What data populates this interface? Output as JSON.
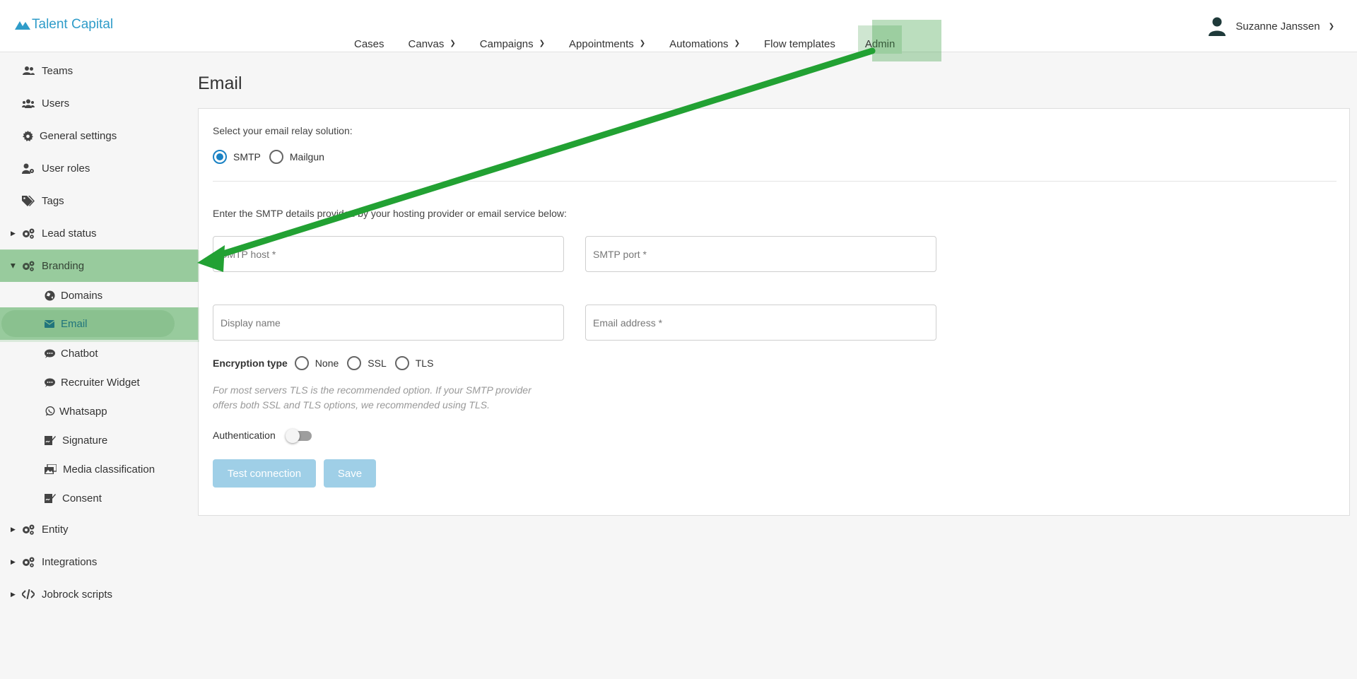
{
  "brand": {
    "name": "Talent Capital"
  },
  "nav": {
    "items": [
      {
        "label": "Cases",
        "has_dropdown": false
      },
      {
        "label": "Canvas",
        "has_dropdown": true
      },
      {
        "label": "Campaigns",
        "has_dropdown": true
      },
      {
        "label": "Appointments",
        "has_dropdown": true
      },
      {
        "label": "Automations",
        "has_dropdown": true
      },
      {
        "label": "Flow templates",
        "has_dropdown": false
      },
      {
        "label": "Admin",
        "has_dropdown": false,
        "highlighted": true
      }
    ]
  },
  "user": {
    "name": "Suzanne Janssen"
  },
  "sidebar": {
    "items": [
      {
        "label": "Teams",
        "icon": "users-icon"
      },
      {
        "label": "Users",
        "icon": "users-group-icon"
      },
      {
        "label": "General settings",
        "icon": "gear-icon"
      },
      {
        "label": "User roles",
        "icon": "user-cog-icon"
      },
      {
        "label": "Tags",
        "icon": "tags-icon"
      },
      {
        "label": "Lead status",
        "icon": "gears-icon",
        "collapsible": true
      },
      {
        "label": "Branding",
        "icon": "gears-icon",
        "collapsible": true,
        "expanded": true,
        "active": true
      },
      {
        "label": "Domains",
        "icon": "globe-icon",
        "sub": true
      },
      {
        "label": "Email",
        "icon": "envelope-icon",
        "sub": true,
        "active": true
      },
      {
        "label": "Chatbot",
        "icon": "comment-icon",
        "sub": true
      },
      {
        "label": "Recruiter Widget",
        "icon": "comment-icon",
        "sub": true
      },
      {
        "label": "Whatsapp",
        "icon": "whatsapp-icon",
        "sub": true
      },
      {
        "label": "Signature",
        "icon": "signature-icon",
        "sub": true
      },
      {
        "label": "Media classification",
        "icon": "images-icon",
        "sub": true
      },
      {
        "label": "Consent",
        "icon": "signature-icon",
        "sub": true
      },
      {
        "label": "Entity",
        "icon": "gears-icon",
        "collapsible": true
      },
      {
        "label": "Integrations",
        "icon": "gears-icon",
        "collapsible": true
      },
      {
        "label": "Jobrock scripts",
        "icon": "code-icon",
        "collapsible": true
      }
    ]
  },
  "main": {
    "title": "Email",
    "relay_prompt": "Select your email relay solution:",
    "relay_options": [
      {
        "label": "SMTP",
        "checked": true
      },
      {
        "label": "Mailgun",
        "checked": false
      }
    ],
    "smtp_prompt": "Enter the SMTP details provided by your hosting provider or email service below:",
    "fields": {
      "smtp_host": {
        "placeholder": "SMTP host *",
        "value": ""
      },
      "smtp_port": {
        "placeholder": "SMTP port *",
        "value": ""
      },
      "display_name": {
        "placeholder": "Display name",
        "value": ""
      },
      "email_address": {
        "placeholder": "Email address *",
        "value": ""
      }
    },
    "encryption": {
      "label": "Encryption type",
      "options": [
        {
          "label": "None",
          "checked": false
        },
        {
          "label": "SSL",
          "checked": false
        },
        {
          "label": "TLS",
          "checked": false
        }
      ],
      "hint_line1": "For most servers TLS is the recommended option. If your SMTP provider",
      "hint_line2": "offers both SSL and TLS options, we recommended using TLS."
    },
    "authentication": {
      "label": "Authentication",
      "enabled": false
    },
    "buttons": {
      "test": "Test connection",
      "save": "Save"
    }
  },
  "colors": {
    "accent": "#1a82c4",
    "brand": "#2f9cc9",
    "highlight": "#a9d3ad",
    "arrow": "#22a133",
    "button_disabled": "#9fcfe7"
  }
}
